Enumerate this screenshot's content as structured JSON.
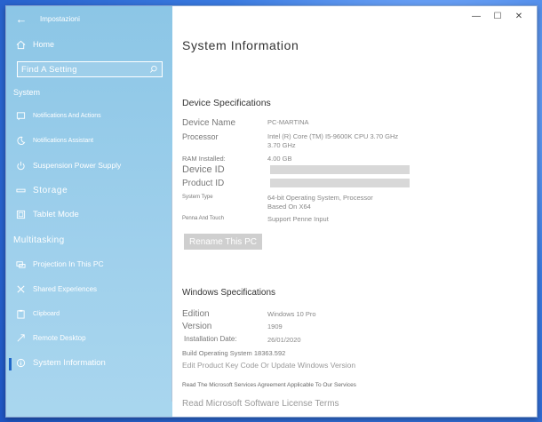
{
  "window": {
    "app_title": "Impostazioni"
  },
  "sidebar": {
    "home_label": "Home",
    "search_placeholder": "Find A Setting",
    "system_header": "System",
    "items": [
      {
        "label": "Notifications And Actions",
        "icon": "notifications-icon"
      },
      {
        "label": "Notifications Assistant",
        "icon": "moon-icon"
      },
      {
        "label": "Suspension Power Supply",
        "icon": "power-icon"
      },
      {
        "label": "Storage",
        "icon": "storage-icon"
      },
      {
        "label": "Tablet Mode",
        "icon": "tablet-icon"
      }
    ],
    "multitasking_header": "Multitasking",
    "items2": [
      {
        "label": "Projection In This PC",
        "icon": "projection-icon"
      },
      {
        "label": "Shared Experiences",
        "icon": "shared-icon"
      },
      {
        "label": "Clipboard",
        "icon": "clipboard-icon"
      },
      {
        "label": "Remote Desktop",
        "icon": "remote-icon"
      },
      {
        "label": "System Information",
        "icon": "info-icon"
      }
    ]
  },
  "content": {
    "title": "System Information",
    "device_specs_header": "Device Specifications",
    "device_name_label": "Device Name",
    "device_name_value": "PC-MARTINA",
    "processor_label": "Processor",
    "processor_value": "Intel (R) Core (TM) I5-9600K CPU 3.70 GHz 3.70 GHz",
    "ram_label": "RAM Installed:",
    "ram_value": "4.00 GB",
    "device_id_label": "Device ID",
    "product_id_label": "Product ID",
    "system_type_label": "System Type",
    "system_type_value": "64-bit Operating System, Processor Based On X64",
    "pen_touch_label": "Penna And Touch",
    "pen_touch_value": "Support Penne Input",
    "rename_button": "Rename This PC",
    "windows_specs_header": "Windows Specifications",
    "edition_label": "Edition",
    "edition_value": "Windows 10 Pro",
    "version_label": "Version",
    "version_value": "1909",
    "install_date_label": "Installation Date:",
    "install_date_value": "26/01/2020",
    "build_text": "Build Operating System 18363.592",
    "edit_product_key_link": "Edit Product Key Code Or Update Windows Version",
    "services_agreement_link": "Read The Microsoft Services Agreement Applicable To Our Services",
    "license_terms_link": "Read Microsoft Software License Terms"
  },
  "colors": {
    "accent": "#1f66c9",
    "sidebar_bg": "#9fd0ec"
  }
}
